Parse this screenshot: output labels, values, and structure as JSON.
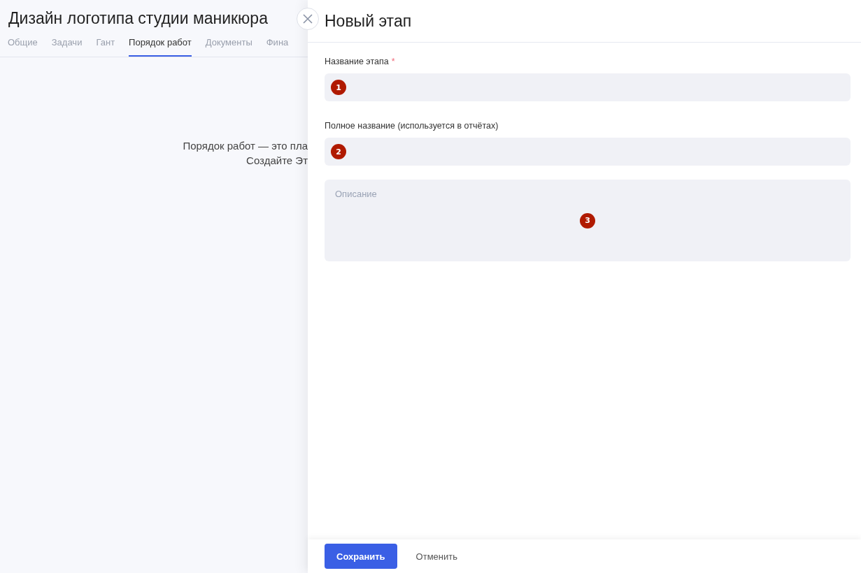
{
  "page": {
    "title": "Дизайн логотипа студии маникюра",
    "tabs": [
      {
        "label": "Общие",
        "selected": false
      },
      {
        "label": "Задачи",
        "selected": false
      },
      {
        "label": "Гант",
        "selected": false
      },
      {
        "label": "Порядок работ",
        "selected": true
      },
      {
        "label": "Документы",
        "selected": false
      },
      {
        "label": "Фина",
        "selected": false
      }
    ],
    "empty_state": [
      "Порядок работ — это пла",
      "Создайте Эт"
    ]
  },
  "drawer": {
    "title": "Новый этап",
    "fields": [
      {
        "kind": "input",
        "label": "Название этапа",
        "required_mark": "*",
        "marker": "1"
      },
      {
        "kind": "input",
        "label": "Полное название (используется в отчётах)",
        "marker": "2"
      },
      {
        "kind": "textarea",
        "placeholder": "Описание",
        "marker": "3"
      }
    ],
    "buttons": [
      {
        "label": "Сохранить",
        "kind": "primary"
      },
      {
        "label": "Отменить",
        "kind": "secondary"
      }
    ]
  }
}
